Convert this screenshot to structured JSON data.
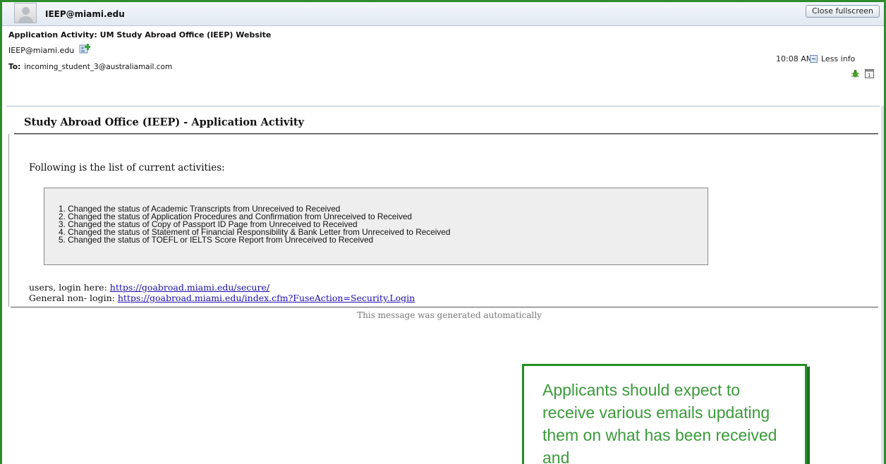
{
  "window": {
    "sender_display": "IEEP@miami.edu",
    "close_fullscreen_label": "Close fullscreen"
  },
  "email": {
    "subject": "Application Activity: UM Study Abroad Office (IEEP) Website",
    "from": "IEEP@miami.edu",
    "to_label": "To:",
    "to": "incoming_student_3@australiamail.com",
    "time": "10:08 AM",
    "less_info_label": "Less info"
  },
  "message": {
    "title": "Study Abroad Office (IEEP) - Application Activity",
    "intro": "Following is the list of current activities:",
    "activities": [
      "1. Changed the status of Academic Transcripts from Unreceived to Received",
      "2. Changed the status of Application Procedures and Confirmation from Unreceived to Received",
      "3. Changed the status of Copy of Passport ID Page from Unreceived to Received",
      "4. Changed the status of Statement of Financial Responsibility & Bank Letter from Unreceived to Received",
      "5. Changed the status of TOEFL or IELTS Score Report from Unreceived to Received"
    ],
    "users_login_label": "users, login here: ",
    "users_login_url": "https://goabroad.miami.edu/secure/",
    "general_login_label": "General non- login: ",
    "general_login_url": "https://goabroad.miami.edu/index.cfm?FuseAction=Security.Login",
    "auto_message": "This message was generated automatically"
  },
  "callout": {
    "text": "Applicants should expect to receive various emails updating them on what has been received and"
  },
  "colors": {
    "frame_border": "#2e8b2e",
    "callout_text": "#3a9a3a",
    "link": "#1a0dab"
  },
  "icons": [
    "avatar-placeholder-icon",
    "add-contact-icon",
    "minus-box-icon",
    "bug-icon",
    "calendar-icon"
  ]
}
